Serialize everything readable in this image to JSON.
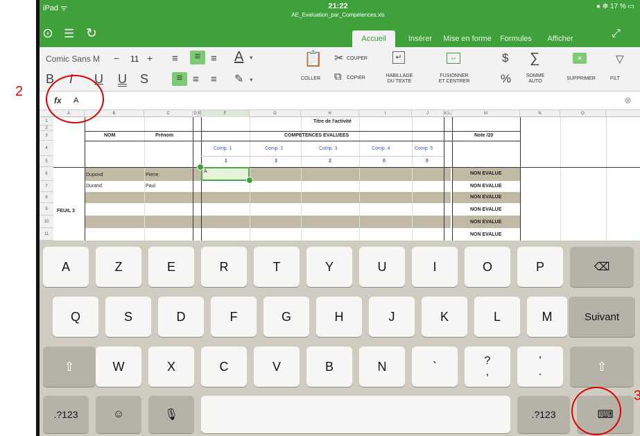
{
  "status": {
    "device": "iPad ᯤ",
    "time": "21:22",
    "filename": "AE_Evaluation_par_Compétences.xls",
    "battery": "● ✻ 17 % ▭"
  },
  "toolbar_top": {
    "icons": [
      "check-circle-icon",
      "list-icon",
      "undo-icon",
      "expand-icon"
    ],
    "tabs": [
      "Accueil",
      "Insérer",
      "Mise en forme",
      "Formules",
      "Afficher"
    ]
  },
  "ribbon": {
    "font_name": "Comic Sans M",
    "font_minus": "−",
    "font_size": "11",
    "font_plus": "+",
    "bold": "B",
    "italic": "I",
    "underline": "U",
    "double_underline": "U",
    "strike": "S",
    "font_color_letter": "A",
    "coller": "COLLER",
    "couper": "COUPER",
    "copier": "COPIER",
    "habillage": "HABILLAGE\nDU TEXTE",
    "fusionner": "FUSIONNER\nET CENTRER",
    "dollar": "$",
    "percent": "%",
    "sigma": "∑",
    "somme": "SOMME\nAUTO",
    "supprimer": "SUPPRIMER",
    "filtrer": "FILT"
  },
  "formula_bar": {
    "fx": "fx",
    "value": "A",
    "clear": "⊗"
  },
  "grid": {
    "columns": [
      "A",
      "B",
      "C",
      "D",
      "E",
      "F",
      "G",
      "H",
      "I",
      "J",
      "K",
      "L",
      "M",
      "N",
      "O"
    ],
    "rows": [
      "1",
      "2",
      "3",
      "4",
      "5",
      "6",
      "7",
      "8",
      "9",
      "10",
      "11"
    ],
    "title": "Titre de l'activité",
    "nom": "NOM",
    "prenom": "Prénom",
    "competences": "COMPETENCES EVALUEES",
    "note": "Note /20",
    "comps": [
      "Comp. 1",
      "Comp. 2",
      "Comp. 3",
      "Comp. 4",
      "Comp. 5"
    ],
    "weights": [
      "1",
      "3",
      "2",
      "0",
      "0"
    ],
    "students": [
      {
        "nom": "Dupond",
        "prenom": "Pierre"
      },
      {
        "nom": "Durand",
        "prenom": "Paul"
      }
    ],
    "selected_value": "A",
    "sheet_label": "FEUIL 3",
    "non_evalue": [
      "NON EVALUE",
      "NON EVALUE",
      "NON EVALUE",
      "NON EVALUE",
      "NON EVALUE",
      "NON EVALUE"
    ]
  },
  "keyboard": {
    "row1": [
      "A",
      "Z",
      "E",
      "R",
      "T",
      "Y",
      "U",
      "I",
      "O",
      "P"
    ],
    "row2": [
      "Q",
      "S",
      "D",
      "F",
      "G",
      "H",
      "J",
      "K",
      "L",
      "M"
    ],
    "row3": [
      "W",
      "X",
      "C",
      "V",
      "B",
      "N",
      "`",
      "?\n,",
      "'\n."
    ],
    "suivant": "Suivant",
    "num_left": ".?123",
    "num_right": ".?123"
  },
  "annotations": {
    "a2": "2",
    "a3": "3"
  }
}
